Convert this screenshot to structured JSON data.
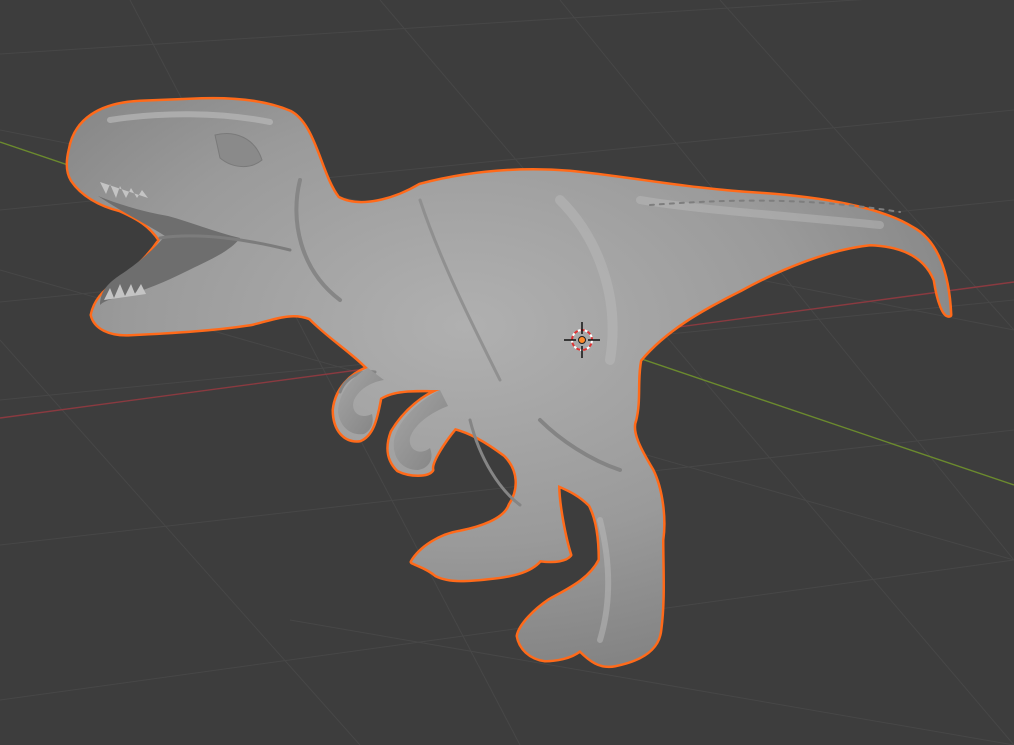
{
  "viewport": {
    "background": "#3d3d3d",
    "grid_color": "#474747",
    "x_axis_color": "#8a3a40",
    "y_axis_color": "#6b8a2e",
    "selection_outline_color": "#ff6a1a",
    "model_color": "#9a9a9a",
    "origin_color": "#ff8a2a"
  },
  "scene": {
    "object": "dinosaur-model",
    "selected": true,
    "cursor_icon": "3d-cursor-icon",
    "origin_icon": "object-origin-icon"
  }
}
